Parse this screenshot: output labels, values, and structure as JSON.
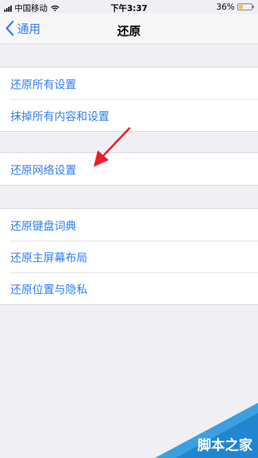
{
  "status": {
    "carrier": "中国移动",
    "time": "下午3:37",
    "battery": "36%",
    "battery_level": 0.36
  },
  "nav": {
    "back_label": "通用",
    "title": "还原"
  },
  "group1": {
    "items": [
      "还原所有设置",
      "抹掉所有内容和设置"
    ]
  },
  "group2": {
    "items": [
      "还原网络设置"
    ]
  },
  "group3": {
    "items": [
      "还原键盘词典",
      "还原主屏幕布局",
      "还原位置与隐私"
    ]
  },
  "watermark": {
    "text": "脚本之家"
  },
  "colors": {
    "accent": "#2f7bf5",
    "background": "#efeff4",
    "arrow": "#e8202a"
  }
}
